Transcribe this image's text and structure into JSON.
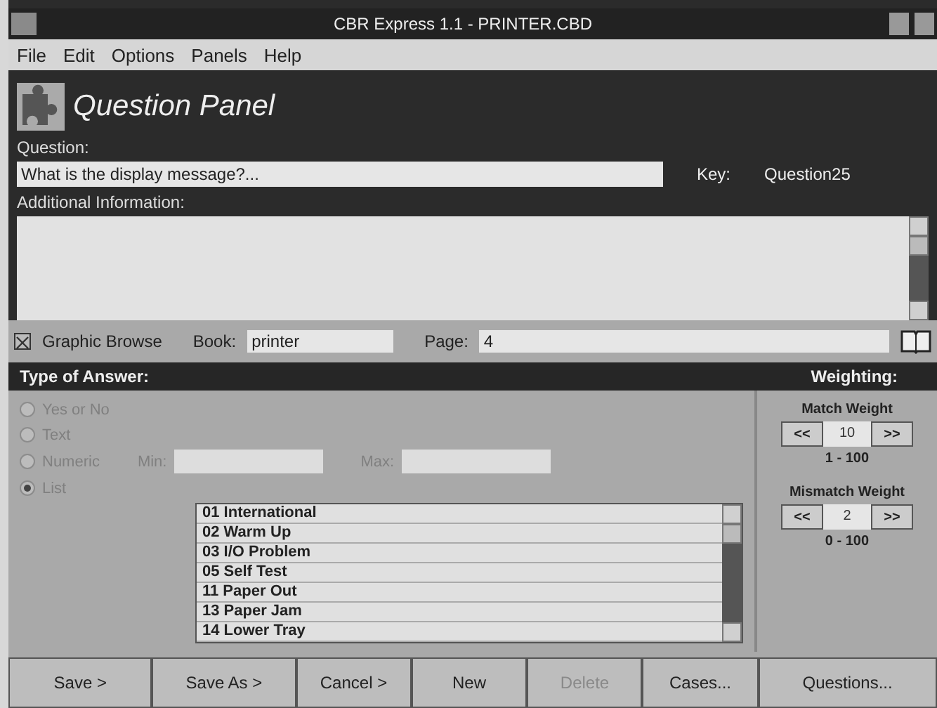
{
  "window": {
    "title": "CBR Express 1.1 - PRINTER.CBD"
  },
  "menu": [
    "File",
    "Edit",
    "Options",
    "Panels",
    "Help"
  ],
  "panel": {
    "title": "Question Panel"
  },
  "question": {
    "label": "Question:",
    "value": "What is the display message?...",
    "key_label": "Key:",
    "key_value": "Question25"
  },
  "additional_info": {
    "label": "Additional Information:"
  },
  "browse": {
    "label": "Graphic Browse",
    "checked": true,
    "book_label": "Book:",
    "book_value": "printer",
    "page_label": "Page:",
    "page_value": "4"
  },
  "answer_type": {
    "header": "Type of Answer:",
    "options": [
      {
        "label": "Yes or No",
        "selected": false,
        "disabled": true
      },
      {
        "label": "Text",
        "selected": false,
        "disabled": true
      },
      {
        "label": "Numeric",
        "selected": false,
        "disabled": true
      },
      {
        "label": "List",
        "selected": true,
        "disabled": true
      }
    ],
    "min_label": "Min:",
    "max_label": "Max:",
    "list_items": [
      "01 International",
      "02 Warm Up",
      "03 I/O Problem",
      "05 Self Test",
      "11 Paper Out",
      "13 Paper Jam",
      "14 Lower Tray"
    ]
  },
  "weighting": {
    "header": "Weighting:",
    "weights": [
      {
        "label": "Match Weight",
        "value": "10",
        "range": "1 - 100",
        "decrease": "<<",
        "increase": ">>"
      },
      {
        "label": "Mismatch Weight",
        "value": "2",
        "range": "0 - 100",
        "decrease": "<<",
        "increase": ">>"
      }
    ]
  },
  "buttons": [
    {
      "label": "Save >",
      "disabled": false
    },
    {
      "label": "Save As >",
      "disabled": false
    },
    {
      "label": "Cancel >",
      "disabled": false
    },
    {
      "label": "New",
      "disabled": false
    },
    {
      "label": "Delete",
      "disabled": true
    },
    {
      "label": "Cases...",
      "disabled": false
    },
    {
      "label": "Questions...",
      "disabled": false
    }
  ]
}
